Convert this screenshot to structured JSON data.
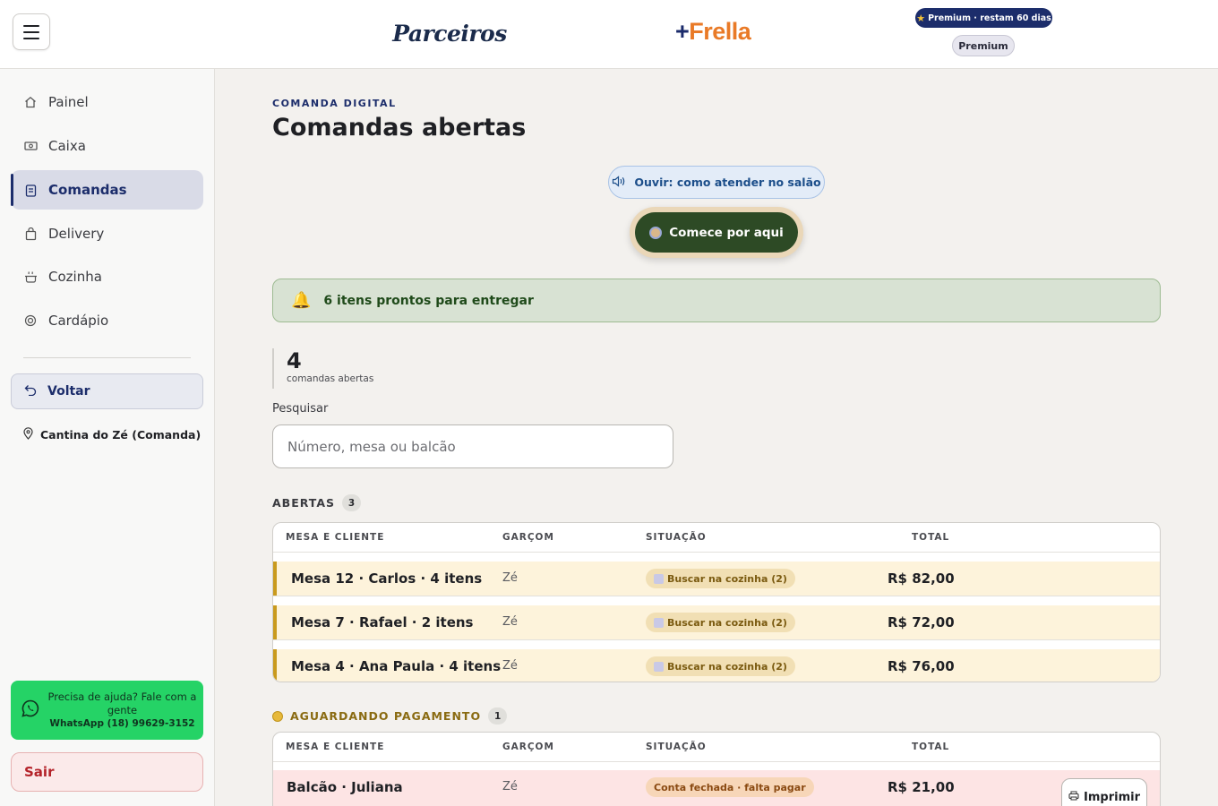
{
  "header": {
    "menu_icon": "hamburger-menu-icon",
    "logo_parceiros": "Parceiros",
    "logo_frella_plus": "+",
    "logo_frella_word": "Frella",
    "premium_pill": "Premium · restam 60 dias",
    "plan_badge": "Premium",
    "colors": {
      "brand_navy": "#1c2d6b",
      "brand_orange": "#e97a27"
    }
  },
  "sidebar": {
    "items": [
      {
        "label": "Painel",
        "icon": "home-icon",
        "active": false
      },
      {
        "label": "Caixa",
        "icon": "cash-icon",
        "active": false
      },
      {
        "label": "Comandas",
        "icon": "clipboard-icon",
        "active": true
      },
      {
        "label": "Delivery",
        "icon": "bag-icon",
        "active": false
      },
      {
        "label": "Cozinha",
        "icon": "pot-icon",
        "active": false
      },
      {
        "label": "Cardápio",
        "icon": "target-icon",
        "active": false
      }
    ],
    "back_label": "Voltar",
    "store_name": "Cantina do Zé (Comanda)",
    "help_line1": "Precisa de ajuda? Fale com a gente",
    "help_phone": "WhatsApp (18) 99629-3152",
    "logout_label": "Sair"
  },
  "main": {
    "eyebrow": "COMANDA DIGITAL",
    "title": "Comandas abertas",
    "listen_button": "Ouvir: como atender no salão",
    "start_button": "Comece por aqui",
    "ready_banner": "6 itens prontos para entregar",
    "stat_value": "4",
    "stat_label": "comandas abertas",
    "search_label": "Pesquisar",
    "search_placeholder": "Número, mesa ou balcão"
  },
  "columns": {
    "c1": "MESA E CLIENTE",
    "c2": "GARÇOM",
    "c3": "SITUAÇÃO",
    "c4": "TOTAL"
  },
  "open_section": {
    "title": "ABERTAS",
    "count": "3",
    "rows": [
      {
        "table": "Mesa 12 · Carlos · 4 itens",
        "waiter": "Zé",
        "status": "Buscar na cozinha (2)",
        "total": "R$ 82,00"
      },
      {
        "table": "Mesa 7 · Rafael · 2 itens",
        "waiter": "Zé",
        "status": "Buscar na cozinha (2)",
        "total": "R$ 72,00"
      },
      {
        "table": "Mesa 4 · Ana Paula · 4 itens",
        "waiter": "Zé",
        "status": "Buscar na cozinha (2)",
        "total": "R$ 76,00"
      }
    ]
  },
  "payment_section": {
    "title": "AGUARDANDO PAGAMENTO",
    "count": "1",
    "rows": [
      {
        "table": "Balcão · Juliana",
        "waiter": "Zé",
        "status": "Conta fechada · falta pagar",
        "total": "R$ 21,00",
        "print": "Imprimir"
      }
    ]
  }
}
